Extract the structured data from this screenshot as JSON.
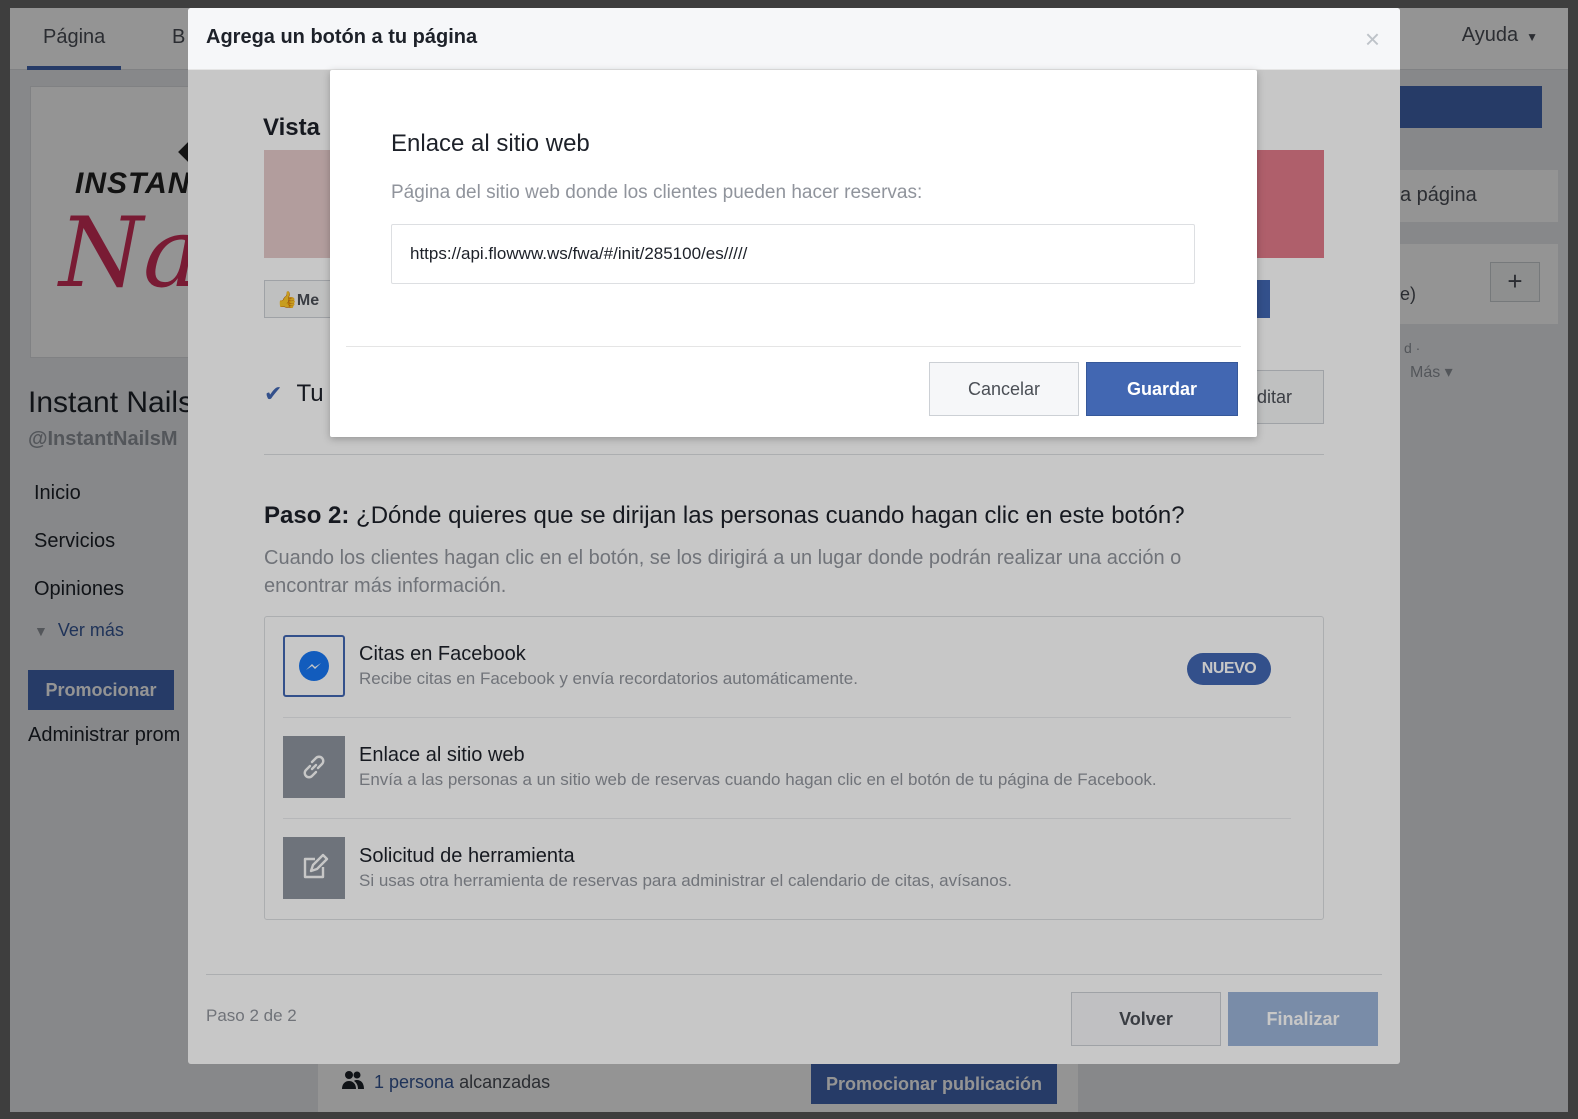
{
  "background_page": {
    "tabs": [
      "Página",
      "B"
    ],
    "help_label": "Ayuda",
    "help_caret": "▼",
    "logo_text_top": "INSTANT",
    "logo_text_script": "Na",
    "page_name": "Instant Nails",
    "page_handle": "@InstantNailsM",
    "sidebar": [
      "Inicio",
      "Servicios",
      "Opiniones"
    ],
    "see_more": "Ver más",
    "promote_button": "Promocionar",
    "manage_promotions": "Administrar prom",
    "right_panel": {
      "page_text": "a página",
      "e_text": "e)",
      "plus": "+",
      "d_text": "d ·",
      "more_text": "Más ▾"
    },
    "reach": {
      "count_link": "1 persona",
      "suffix": " alcanzadas"
    },
    "promote_post": "Promocionar publicación"
  },
  "dialog": {
    "title": "Agrega un botón a tu página",
    "close_glyph": "×",
    "preview_heading": "Vista",
    "like_button": "Me",
    "check_text": "Tu",
    "edit_button": "ditar",
    "step2_bold": "Paso 2:",
    "step2_question": " ¿Dónde quieres que se dirijan las personas cuando hagan clic en este botón?",
    "step2_description": "Cuando los clientes hagan clic en el botón, se los dirigirá a un lugar donde podrán realizar una acción o encontrar más información.",
    "options": [
      {
        "title": "Citas en Facebook",
        "subtitle": "Recibe citas en Facebook y envía recordatorios automáticamente.",
        "badge": "NUEVO",
        "icon": "messenger-icon"
      },
      {
        "title": "Enlace al sitio web",
        "subtitle": "Envía a las personas a un sitio web de reservas cuando hagan clic en el botón de tu página de Facebook.",
        "icon": "link-icon"
      },
      {
        "title": "Solicitud de herramienta",
        "subtitle": "Si usas otra herramienta de reservas para administrar el calendario de citas, avísanos.",
        "icon": "edit-icon"
      }
    ],
    "step_counter": "Paso 2 de 2",
    "back_button": "Volver",
    "finish_button": "Finalizar"
  },
  "inner_dialog": {
    "title": "Enlace al sitio web",
    "label": "Página del sitio web donde los clientes pueden hacer reservas:",
    "url_value": "https://api.flowww.ws/fwa/#/init/285100/es/////",
    "cancel_button": "Cancelar",
    "save_button": "Guardar"
  },
  "colors": {
    "brand_blue": "#4267b2",
    "disabled_blue": "#9cb4d8",
    "link_blue": "#365899",
    "muted_text": "#90949c"
  }
}
